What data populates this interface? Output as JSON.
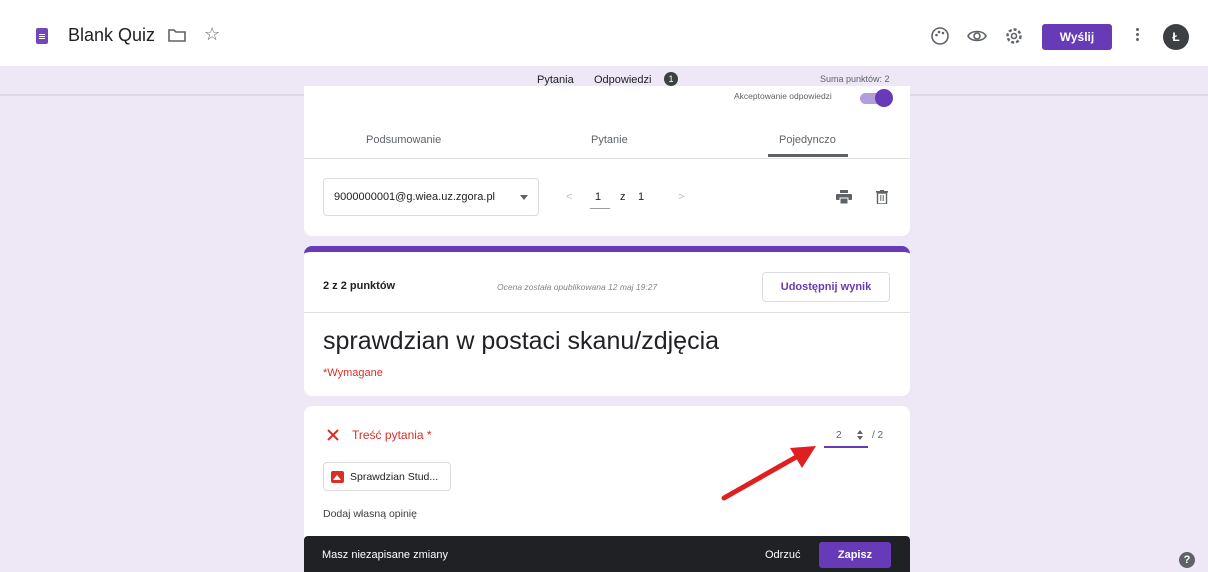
{
  "app": {
    "title": "Blank Quiz"
  },
  "header": {
    "send_label": "Wyślij",
    "avatar_initial": "Ł"
  },
  "tabs": [
    {
      "label": "Pytania"
    },
    {
      "label": "Odpowiedzi",
      "badge": "1"
    }
  ],
  "total_points": "Suma punktów: 2",
  "responses": {
    "accepting_label": "Akceptowanie odpowiedzi",
    "accepting": true,
    "view_tabs": [
      {
        "label": "Podsumowanie"
      },
      {
        "label": "Pytanie"
      },
      {
        "label": "Pojedynczo"
      }
    ],
    "respondent_email": "9000000001@g.wiea.uz.zgora.pl",
    "pager": {
      "current": "1",
      "of": "z",
      "total": "1",
      "prev": "<",
      "next": ">"
    }
  },
  "score_card": {
    "score": "2 z 2 punktów",
    "published": "Ocena została opublikowana 12 maj 19:27",
    "share_label": "Udostępnij wynik",
    "form_title": "sprawdzian w postaci skanu/zdjęcia",
    "required_note": "*Wymagane"
  },
  "question": {
    "title": "Treść pytania *",
    "points_value": "2",
    "points_max": "/ 2",
    "attachment_label": "Sprawdzian Stud...",
    "feedback_label": "Dodaj własną opinię"
  },
  "snackbar": {
    "message": "Masz niezapisane zmiany",
    "discard_label": "Odrzuć",
    "save_label": "Zapisz"
  },
  "colors": {
    "accent": "#673ab7",
    "background": "#ede7f6",
    "error": "#d93025",
    "arrow": "#e02020"
  }
}
